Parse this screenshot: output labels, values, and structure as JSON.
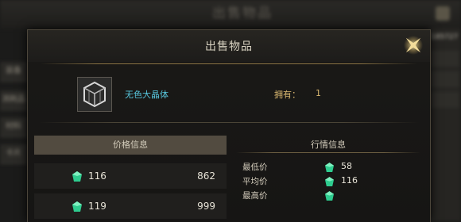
{
  "background": {
    "title": "出售物品",
    "sidebar_tabs": [
      "装备",
      "消耗品",
      "材料",
      "卡片"
    ],
    "right_text": "185727"
  },
  "dialog": {
    "title": "出售物品",
    "close_icon": "star-close-icon",
    "item": {
      "icon": "crystal-cube-icon",
      "name": "无色大晶体",
      "owned_label": "拥有：",
      "owned_value": "1"
    },
    "price_panel": {
      "header": "价格信息",
      "currency_icon": "green-gem-icon",
      "rows": [
        {
          "quantity": "116",
          "amount": "862"
        },
        {
          "quantity": "119",
          "amount": "999"
        }
      ]
    },
    "market_panel": {
      "title": "行情信息",
      "rows": [
        {
          "label": "最低价",
          "value": "58"
        },
        {
          "label": "平均价",
          "value": "116"
        },
        {
          "label": "最高价",
          "value": ""
        }
      ]
    }
  },
  "colors": {
    "item_name": "#58c7de",
    "owned": "#d7b66f",
    "gold_accent": "#e3c36e",
    "gem": "#2ecc8f"
  }
}
